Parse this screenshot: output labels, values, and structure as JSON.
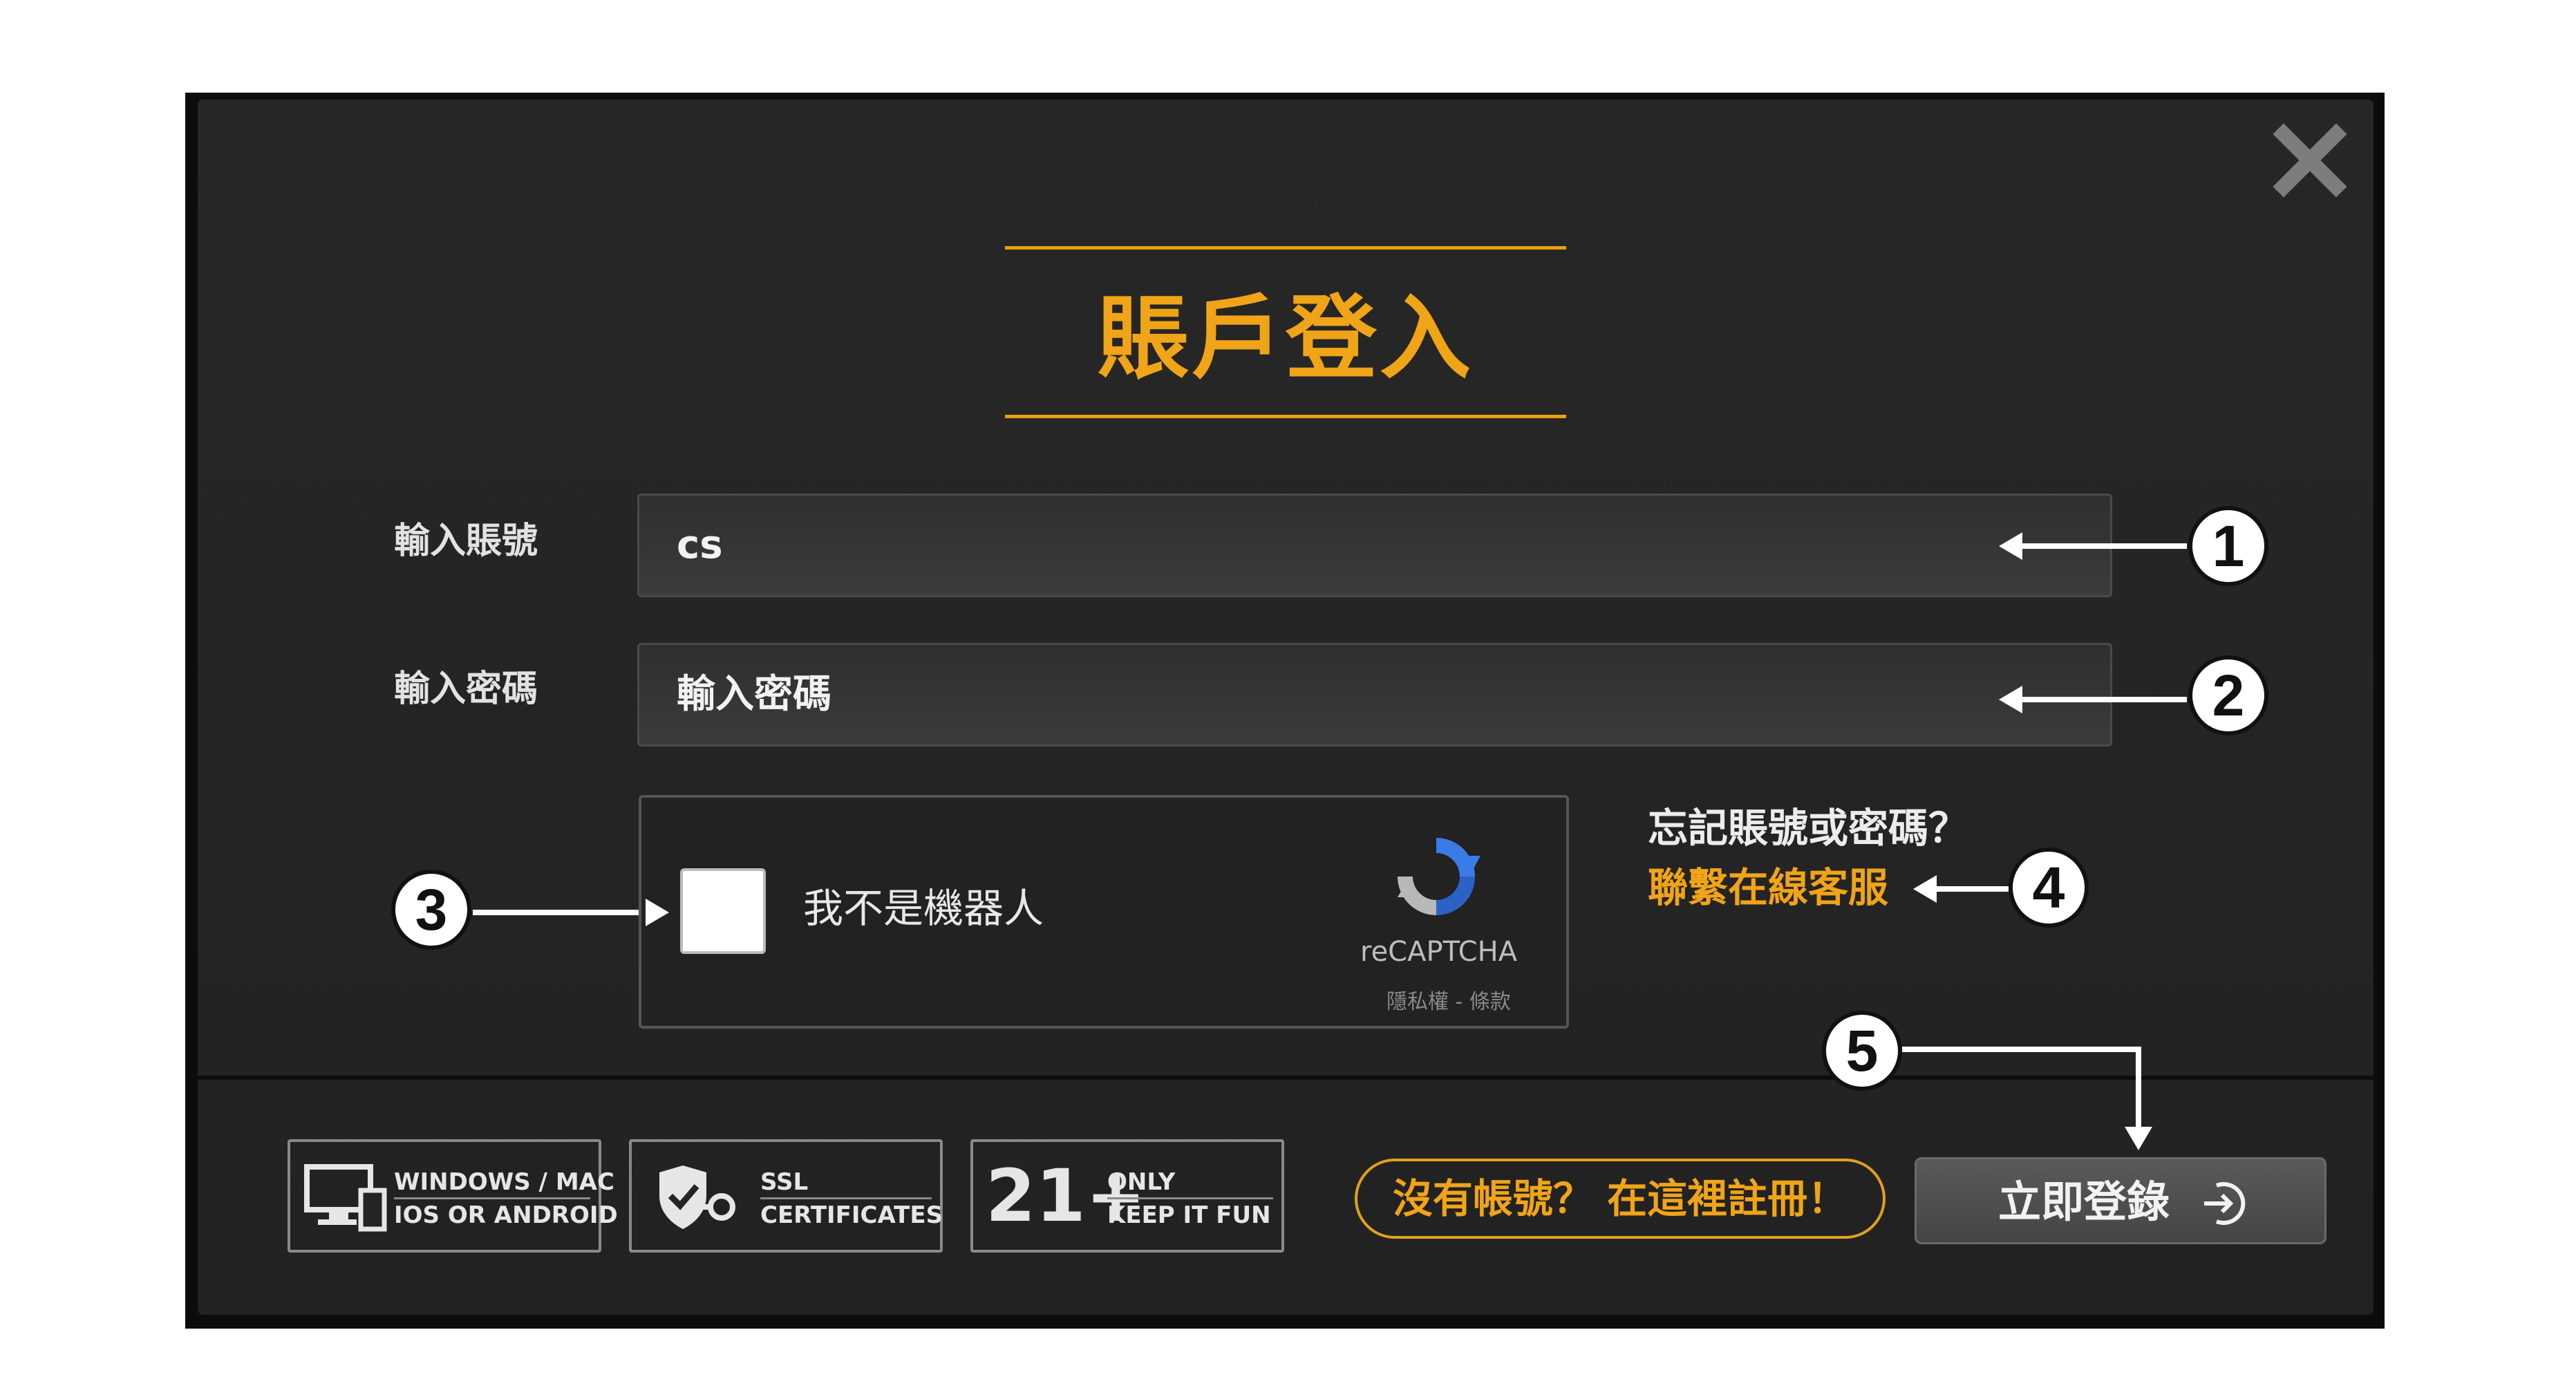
{
  "modal": {
    "title": "賬戶登入",
    "account": {
      "label": "輸入賬號",
      "value": "cs"
    },
    "password": {
      "label": "輸入密碼",
      "placeholder": "輸入密碼"
    },
    "captcha": {
      "text": "我不是機器人",
      "brand": "reCAPTCHA",
      "terms": "隱私權 - 條款"
    },
    "forgot": {
      "question": "忘記賬號或密碼？",
      "contact": "聯繫在線客服"
    },
    "footer": {
      "platform": {
        "line1": "WINDOWS / MAC",
        "line2": "IOS OR ANDROID"
      },
      "ssl": {
        "line1": "SSL",
        "line2": "CERTIFICATES"
      },
      "age": {
        "big": "21+",
        "line1": "ONLY",
        "line2": "KEEP IT FUN"
      },
      "register": "沒有帳號？ 在這裡註冊！",
      "login": "立即登錄"
    }
  },
  "annotations": [
    "1",
    "2",
    "3",
    "4",
    "5"
  ],
  "colors": {
    "accent": "#f0a418",
    "panel": "#242424",
    "button": "#505050"
  }
}
